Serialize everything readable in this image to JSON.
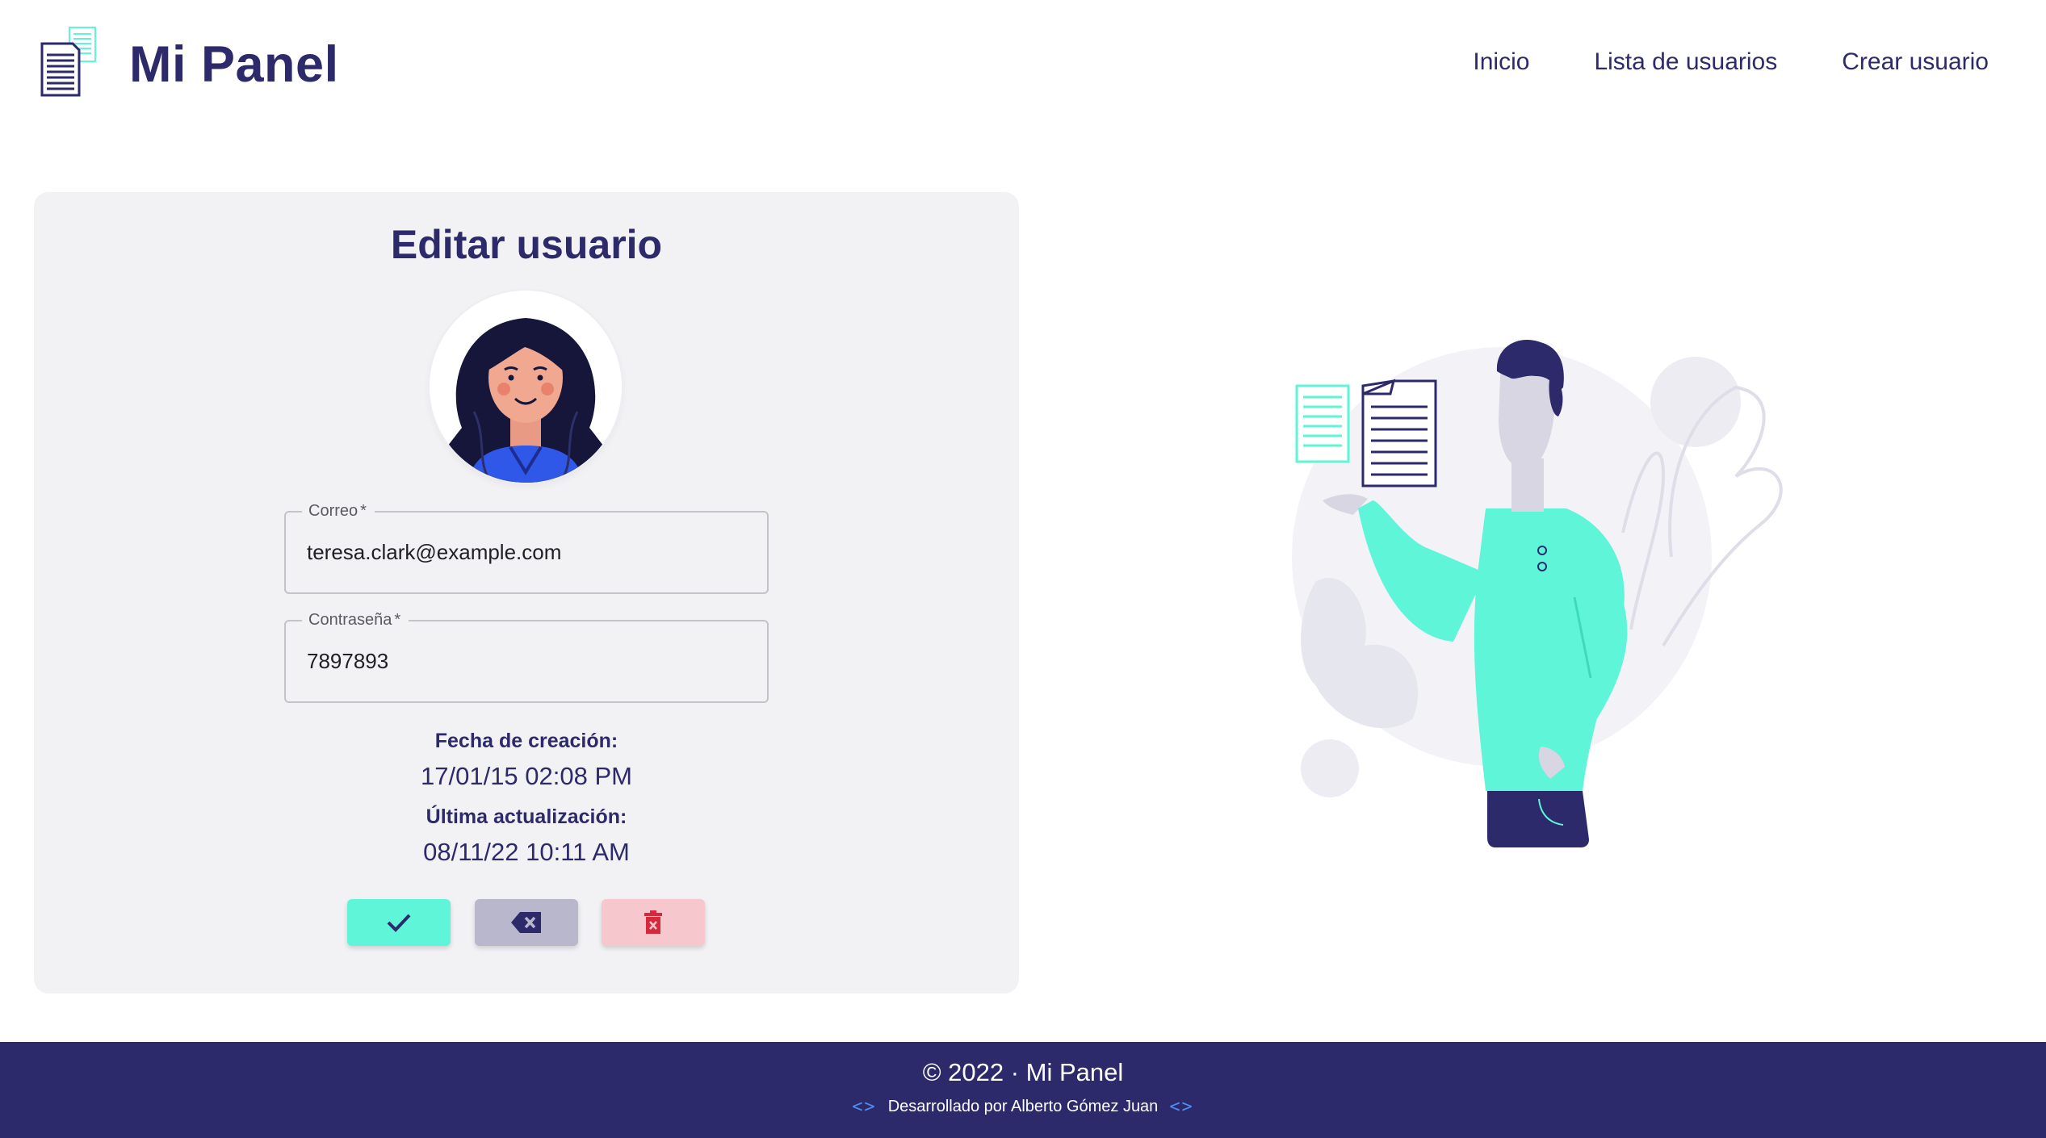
{
  "header": {
    "brand": "Mi Panel",
    "nav": [
      "Inicio",
      "Lista de usuarios",
      "Crear usuario"
    ]
  },
  "form": {
    "title": "Editar usuario",
    "email": {
      "label": "Correo",
      "required_mark": "*",
      "value": "teresa.clark@example.com"
    },
    "password": {
      "label": "Contraseña",
      "required_mark": "*",
      "value": "7897893"
    },
    "created": {
      "label": "Fecha de creación:",
      "value": "17/01/15 02:08 PM"
    },
    "updated": {
      "label": "Última actualización:",
      "value": "08/11/22 10:11 AM"
    },
    "buttons": {
      "save_icon": "check-icon",
      "cancel_icon": "backspace-x-icon",
      "delete_icon": "trash-icon"
    }
  },
  "footer": {
    "copyright": "© 2022 · Mi Panel",
    "developer": "Desarrollado por Alberto Gómez Juan"
  },
  "colors": {
    "primary": "#2d2a6b",
    "accent": "#5ff5d8",
    "card_bg": "#f2f2f5",
    "cancel": "#b8b7cb",
    "delete": "#f6c7cd",
    "delete_icon": "#d42a3c",
    "code_icon": "#4b8ff5"
  }
}
